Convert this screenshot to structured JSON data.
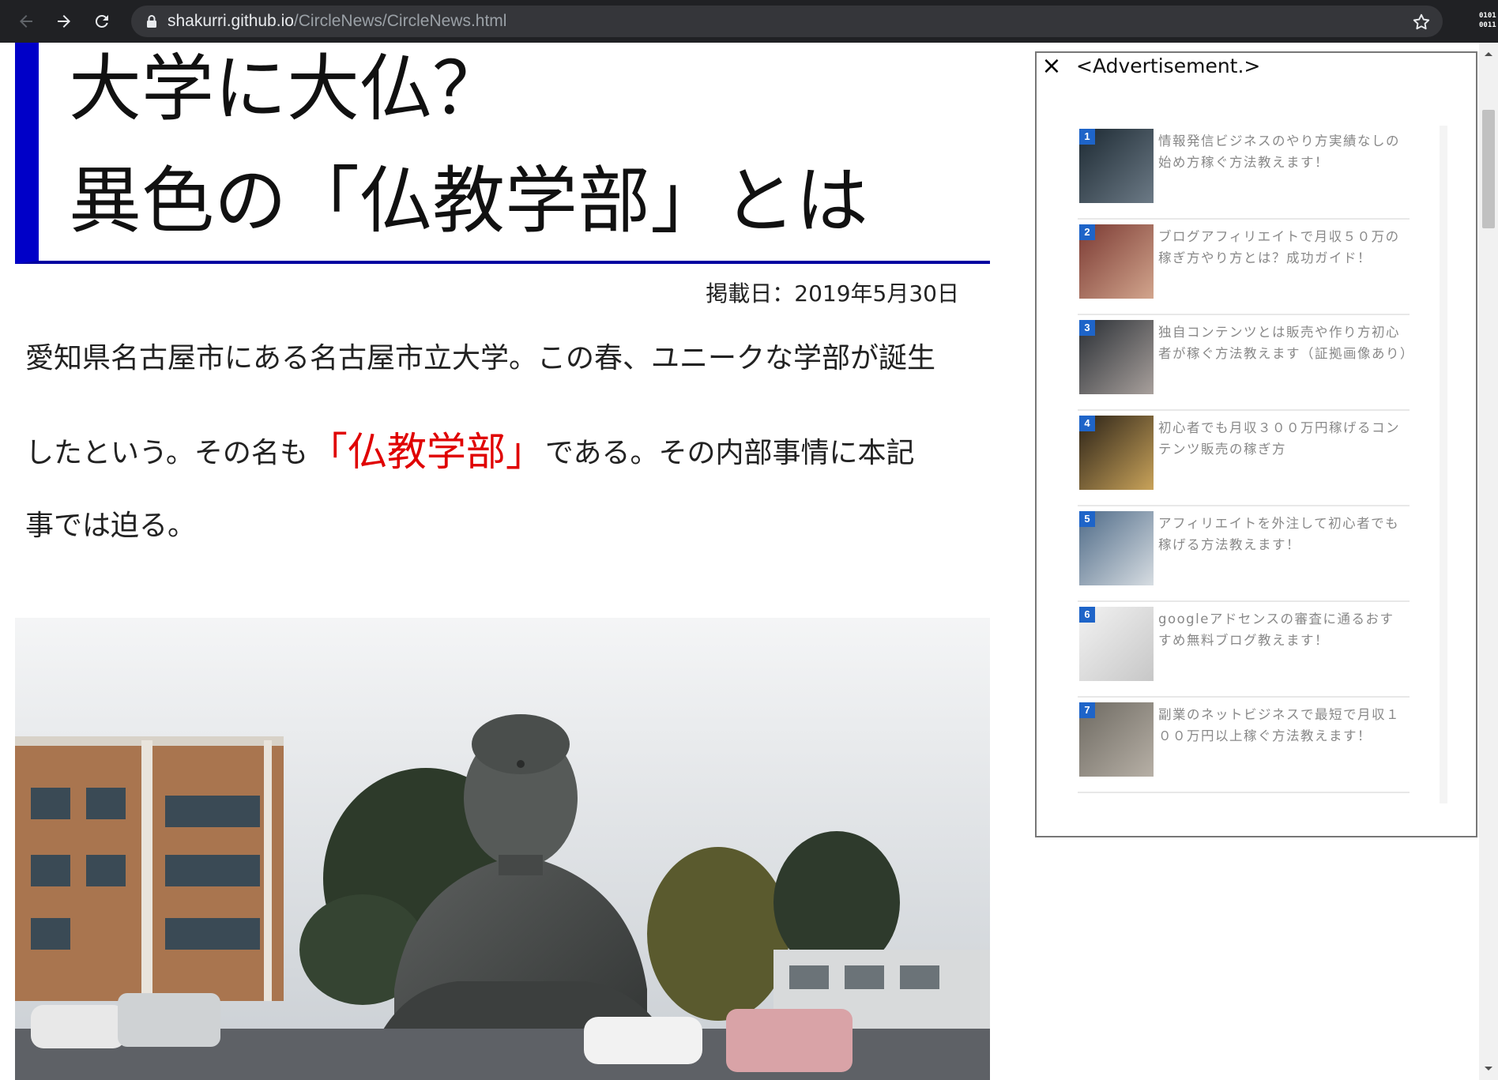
{
  "browser": {
    "url_host": "shakurri.github.io",
    "url_path": "/CircleNews/CircleNews.html",
    "extension_text": "0101 0011"
  },
  "article": {
    "headline_line1": "大学に大仏？",
    "headline_line2": "異色の「仏教学部」とは",
    "published": "掲載日：2019年5月30日",
    "body_line1": "愛知県名古屋市にある名古屋市立大学。この春、ユニークな学部が誕生",
    "body_line2_before": "したという。その名も",
    "body_line2_highlight": "「仏教学部」",
    "body_line2_after": "である。その内部事情に本記",
    "body_line3": "事では迫る。",
    "accent_color": "#0000c8",
    "highlight_color": "#e00000"
  },
  "ad": {
    "close_symbol": "×",
    "title": "<Advertisement.>",
    "items": [
      {
        "rank": "1",
        "text": "情報発信ビジネスのやり方実績なしの始め方稼ぐ方法教えます！"
      },
      {
        "rank": "2",
        "text": "ブログアフィリエイトで月収５０万の稼ぎ方やり方とは？成功ガイド！"
      },
      {
        "rank": "3",
        "text": "独自コンテンツとは販売や作り方初心者が稼ぐ方法教えます（証拠画像あり）"
      },
      {
        "rank": "4",
        "text": "初心者でも月収３００万円稼げるコンテンツ販売の稼ぎ方"
      },
      {
        "rank": "5",
        "text": "アフィリエイトを外注して初心者でも稼げる方法教えます！"
      },
      {
        "rank": "6",
        "text": "googleアドセンスの審査に通るおすすめ無料ブログ教えます！"
      },
      {
        "rank": "7",
        "text": "副業のネットビジネスで最短で月収１００万円以上稼ぐ方法教えます！"
      }
    ]
  }
}
